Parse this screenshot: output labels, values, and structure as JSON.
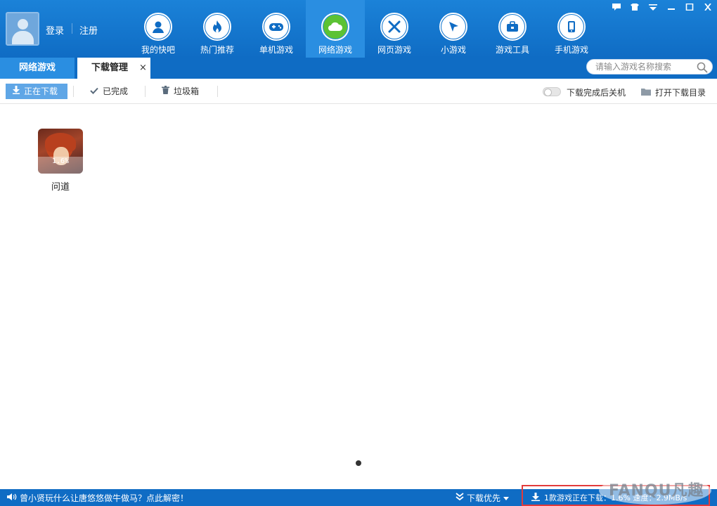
{
  "user": {
    "login_label": "登录",
    "register_label": "注册"
  },
  "nav": [
    {
      "label": "我的快吧",
      "icon": "user-icon",
      "active": false
    },
    {
      "label": "热门推荐",
      "icon": "flame-icon",
      "active": false
    },
    {
      "label": "单机游戏",
      "icon": "gamepad-icon",
      "active": false
    },
    {
      "label": "网络游戏",
      "icon": "cloud-icon",
      "active": true
    },
    {
      "label": "网页游戏",
      "icon": "swords-icon",
      "active": false
    },
    {
      "label": "小游戏",
      "icon": "cursor-icon",
      "active": false
    },
    {
      "label": "游戏工具",
      "icon": "toolbox-icon",
      "active": false
    },
    {
      "label": "手机游戏",
      "icon": "phone-icon",
      "active": false
    }
  ],
  "tabs": {
    "net_games": "网络游戏",
    "download_manager": "下载管理",
    "close_symbol": "×"
  },
  "search": {
    "placeholder": "请输入游戏名称搜索"
  },
  "toolbar": {
    "downloading": "正在下载",
    "completed": "已完成",
    "trash": "垃圾箱",
    "shutdown_after": "下载完成后关机",
    "open_dir": "打开下载目录"
  },
  "downloads": [
    {
      "name": "问道",
      "progress_label": "1.6%",
      "progress": 0.016
    }
  ],
  "statusbar": {
    "notice": "曾小贤玩什么让唐悠悠做牛做马？点此解密！",
    "priority": "下载优先",
    "status": "1款游戏正在下载：1.6% 速度：2.9MB/s"
  },
  "watermark": {
    "text": "FANQU凡趣"
  },
  "colors": {
    "header_blue": "#0f6cc4",
    "active_green": "#5cc234",
    "highlight_red": "#e23b3b"
  }
}
